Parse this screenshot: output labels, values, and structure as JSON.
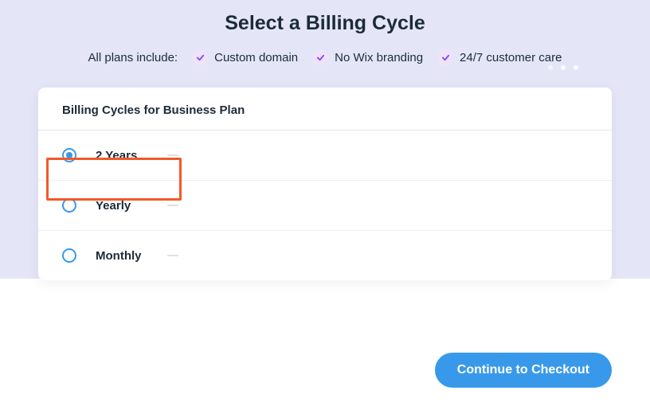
{
  "title": "Select a Billing Cycle",
  "features_intro": "All plans include:",
  "features": {
    "f0": "Custom domain",
    "f1": "No Wix branding",
    "f2": "24/7 customer care"
  },
  "card": {
    "header": "Billing Cycles for Business Plan",
    "options": {
      "o0": "2 Years",
      "o1": "Yearly",
      "o2": "Monthly"
    }
  },
  "checkout_label": "Continue to Checkout"
}
